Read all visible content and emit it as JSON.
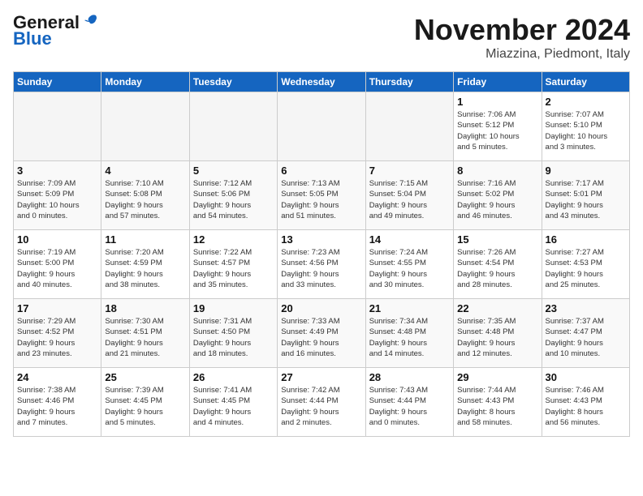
{
  "header": {
    "logo_general": "General",
    "logo_blue": "Blue",
    "month_title": "November 2024",
    "location": "Miazzina, Piedmont, Italy"
  },
  "weekdays": [
    "Sunday",
    "Monday",
    "Tuesday",
    "Wednesday",
    "Thursday",
    "Friday",
    "Saturday"
  ],
  "weeks": [
    [
      {
        "day": "",
        "info": ""
      },
      {
        "day": "",
        "info": ""
      },
      {
        "day": "",
        "info": ""
      },
      {
        "day": "",
        "info": ""
      },
      {
        "day": "",
        "info": ""
      },
      {
        "day": "1",
        "info": "Sunrise: 7:06 AM\nSunset: 5:12 PM\nDaylight: 10 hours\nand 5 minutes."
      },
      {
        "day": "2",
        "info": "Sunrise: 7:07 AM\nSunset: 5:10 PM\nDaylight: 10 hours\nand 3 minutes."
      }
    ],
    [
      {
        "day": "3",
        "info": "Sunrise: 7:09 AM\nSunset: 5:09 PM\nDaylight: 10 hours\nand 0 minutes."
      },
      {
        "day": "4",
        "info": "Sunrise: 7:10 AM\nSunset: 5:08 PM\nDaylight: 9 hours\nand 57 minutes."
      },
      {
        "day": "5",
        "info": "Sunrise: 7:12 AM\nSunset: 5:06 PM\nDaylight: 9 hours\nand 54 minutes."
      },
      {
        "day": "6",
        "info": "Sunrise: 7:13 AM\nSunset: 5:05 PM\nDaylight: 9 hours\nand 51 minutes."
      },
      {
        "day": "7",
        "info": "Sunrise: 7:15 AM\nSunset: 5:04 PM\nDaylight: 9 hours\nand 49 minutes."
      },
      {
        "day": "8",
        "info": "Sunrise: 7:16 AM\nSunset: 5:02 PM\nDaylight: 9 hours\nand 46 minutes."
      },
      {
        "day": "9",
        "info": "Sunrise: 7:17 AM\nSunset: 5:01 PM\nDaylight: 9 hours\nand 43 minutes."
      }
    ],
    [
      {
        "day": "10",
        "info": "Sunrise: 7:19 AM\nSunset: 5:00 PM\nDaylight: 9 hours\nand 40 minutes."
      },
      {
        "day": "11",
        "info": "Sunrise: 7:20 AM\nSunset: 4:59 PM\nDaylight: 9 hours\nand 38 minutes."
      },
      {
        "day": "12",
        "info": "Sunrise: 7:22 AM\nSunset: 4:57 PM\nDaylight: 9 hours\nand 35 minutes."
      },
      {
        "day": "13",
        "info": "Sunrise: 7:23 AM\nSunset: 4:56 PM\nDaylight: 9 hours\nand 33 minutes."
      },
      {
        "day": "14",
        "info": "Sunrise: 7:24 AM\nSunset: 4:55 PM\nDaylight: 9 hours\nand 30 minutes."
      },
      {
        "day": "15",
        "info": "Sunrise: 7:26 AM\nSunset: 4:54 PM\nDaylight: 9 hours\nand 28 minutes."
      },
      {
        "day": "16",
        "info": "Sunrise: 7:27 AM\nSunset: 4:53 PM\nDaylight: 9 hours\nand 25 minutes."
      }
    ],
    [
      {
        "day": "17",
        "info": "Sunrise: 7:29 AM\nSunset: 4:52 PM\nDaylight: 9 hours\nand 23 minutes."
      },
      {
        "day": "18",
        "info": "Sunrise: 7:30 AM\nSunset: 4:51 PM\nDaylight: 9 hours\nand 21 minutes."
      },
      {
        "day": "19",
        "info": "Sunrise: 7:31 AM\nSunset: 4:50 PM\nDaylight: 9 hours\nand 18 minutes."
      },
      {
        "day": "20",
        "info": "Sunrise: 7:33 AM\nSunset: 4:49 PM\nDaylight: 9 hours\nand 16 minutes."
      },
      {
        "day": "21",
        "info": "Sunrise: 7:34 AM\nSunset: 4:48 PM\nDaylight: 9 hours\nand 14 minutes."
      },
      {
        "day": "22",
        "info": "Sunrise: 7:35 AM\nSunset: 4:48 PM\nDaylight: 9 hours\nand 12 minutes."
      },
      {
        "day": "23",
        "info": "Sunrise: 7:37 AM\nSunset: 4:47 PM\nDaylight: 9 hours\nand 10 minutes."
      }
    ],
    [
      {
        "day": "24",
        "info": "Sunrise: 7:38 AM\nSunset: 4:46 PM\nDaylight: 9 hours\nand 7 minutes."
      },
      {
        "day": "25",
        "info": "Sunrise: 7:39 AM\nSunset: 4:45 PM\nDaylight: 9 hours\nand 5 minutes."
      },
      {
        "day": "26",
        "info": "Sunrise: 7:41 AM\nSunset: 4:45 PM\nDaylight: 9 hours\nand 4 minutes."
      },
      {
        "day": "27",
        "info": "Sunrise: 7:42 AM\nSunset: 4:44 PM\nDaylight: 9 hours\nand 2 minutes."
      },
      {
        "day": "28",
        "info": "Sunrise: 7:43 AM\nSunset: 4:44 PM\nDaylight: 9 hours\nand 0 minutes."
      },
      {
        "day": "29",
        "info": "Sunrise: 7:44 AM\nSunset: 4:43 PM\nDaylight: 8 hours\nand 58 minutes."
      },
      {
        "day": "30",
        "info": "Sunrise: 7:46 AM\nSunset: 4:43 PM\nDaylight: 8 hours\nand 56 minutes."
      }
    ]
  ]
}
